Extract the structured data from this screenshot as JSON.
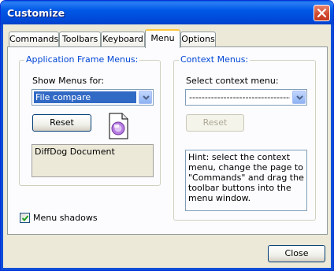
{
  "window": {
    "title": "Customize",
    "close_label": "Close"
  },
  "tabs": [
    {
      "label": "Commands",
      "active": false
    },
    {
      "label": "Toolbars",
      "active": false
    },
    {
      "label": "Keyboard",
      "active": false
    },
    {
      "label": "Menu",
      "active": true
    },
    {
      "label": "Options",
      "active": false
    }
  ],
  "app_frame": {
    "group_title": "Application Frame Menus:",
    "show_menus_label": "Show Menus for:",
    "show_menus_value": "File compare",
    "reset_label": "Reset",
    "list_items": [
      "DiffDog Document"
    ],
    "doc_icon": "diffdog-document-icon"
  },
  "context": {
    "group_title": "Context Menus:",
    "select_label": "Select context menu:",
    "select_value": "------------------------------------------",
    "reset_label": "Reset",
    "hint": "Hint: select the context menu, change the page to \"Commands\" and drag the toolbar buttons into the menu window."
  },
  "options": {
    "menu_shadows_label": "Menu shadows",
    "menu_shadows_checked": true
  },
  "colors": {
    "titlebar": "#0058e6",
    "group_title": "#0046d5",
    "selection": "#316ac5",
    "active_tab_highlight": "#ffc83c"
  }
}
